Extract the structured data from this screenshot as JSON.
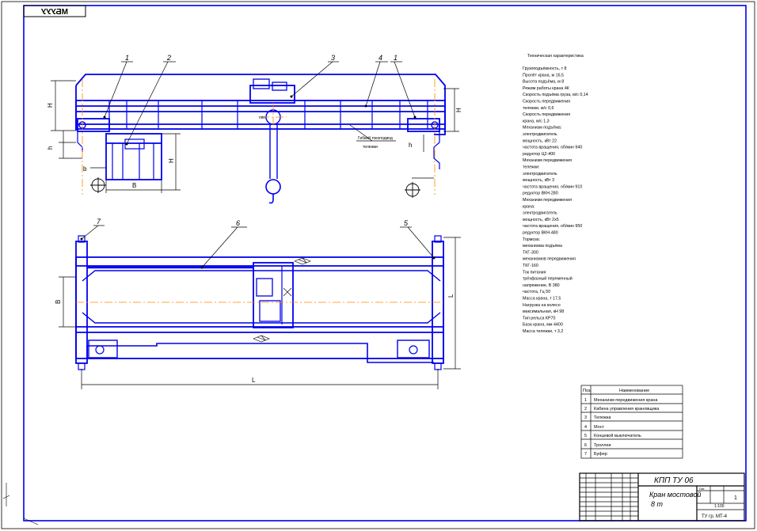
{
  "drawing_code_mirrored": "МБУУУ",
  "callouts": [
    "1",
    "2",
    "3",
    "4",
    "1",
    "7",
    "6",
    "5"
  ],
  "dimension_labels": {
    "left_height": "H",
    "left_low": "h",
    "left_small": "b",
    "base_width": "B",
    "base_height": "H",
    "cab_height": "h",
    "right_height": "H",
    "right_low": "h",
    "bottom_depth": "B",
    "bottom_height": "L",
    "span": "L"
  },
  "hook_notes": [
    "",
    "max",
    "min"
  ],
  "trolley_leader_text": [
    "Гибкий токоподвод",
    "тележки"
  ],
  "tech_specs": {
    "title": "Техническая характеристика",
    "lines": [
      "Грузоподъёмность, т 8",
      "Пролёт крана, м 16,5",
      "Высота подъёма, м 8",
      "Режим работы крана 4К",
      "Скорость подъёма груза, м/с 0,14",
      "Скорость передвижения",
      "тележки, м/с 0,6",
      "Скорость передвижения",
      "крана, м/с 1,3",
      "Механизм подъёма:",
      "электродвигатель",
      "мощность, кВт 22",
      "частота вращения, об/мин 940",
      "редуктор Ц2-400",
      "Механизм передвижения",
      "тележки:",
      "электродвигатель",
      "мощность, кВт 3",
      "частота вращения, об/мин 910",
      "редуктор ВКН-280",
      "Механизм передвижения",
      "крана:",
      "электродвигатель",
      "мощность, кВт 2x5",
      "частота вращения, об/мин 950",
      "редуктор ВКН-480",
      "Тормоза:",
      "механизма подъёма",
      "ТКГ-300",
      "механизмов передвижения",
      "ТКГ-160",
      "Ток питания",
      "трёхфазный переменный",
      "напряжение, В 380",
      "частота, Гц 50",
      "Масса крана, т 17,5",
      "Нагрузка на колесо",
      "максимальная, кН 98",
      "Тип рельса КР70",
      "База крана, мм 4400",
      "Масса тележки, т 3,2"
    ]
  },
  "parts_table": {
    "header": [
      "Поз.",
      "Наименование"
    ],
    "rows": [
      [
        "1",
        "Механизм передвижения крана"
      ],
      [
        "2",
        "Кабина управления крановщика"
      ],
      [
        "3",
        "Тележка"
      ],
      [
        "4",
        "Мост"
      ],
      [
        "5",
        "Концевой выключатель"
      ],
      [
        "6",
        "Троллеи"
      ],
      [
        "7",
        "Буфер"
      ]
    ]
  },
  "title_block": {
    "code": "КПП ТУ 06",
    "name": [
      "Кран мостовой",
      "8 т"
    ],
    "sheet": "1",
    "sheets_label": "Лит.",
    "scale": "1:100",
    "org": "ТУ гр. МТ-4"
  },
  "colors": {
    "main": "#0000ee",
    "axis": "#ff8800",
    "paper": "#ffffff",
    "text": "#000000"
  }
}
